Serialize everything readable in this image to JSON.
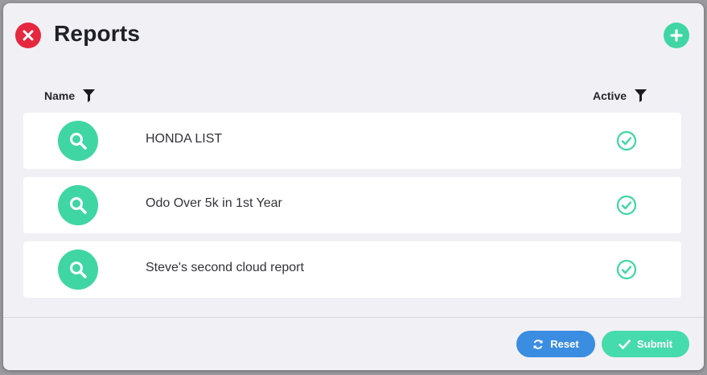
{
  "header": {
    "title": "Reports"
  },
  "columns": {
    "name": "Name",
    "active": "Active"
  },
  "reports": [
    {
      "name": "HONDA LIST",
      "active": true
    },
    {
      "name": "Odo Over 5k in 1st Year",
      "active": true
    },
    {
      "name": "Steve's second cloud report",
      "active": true
    }
  ],
  "footer": {
    "reset_label": "Reset",
    "submit_label": "Submit"
  },
  "colors": {
    "close": "#e5273f",
    "accent": "#3fd6a4",
    "reset": "#3a8de0",
    "submit": "#46dbac",
    "background": "#f1f0f5"
  },
  "icons": {
    "close": "close-icon",
    "add": "plus-icon",
    "filter": "filter-icon",
    "row": "search-icon",
    "active": "check-circle-icon",
    "reset": "refresh-icon",
    "submit": "check-icon"
  }
}
